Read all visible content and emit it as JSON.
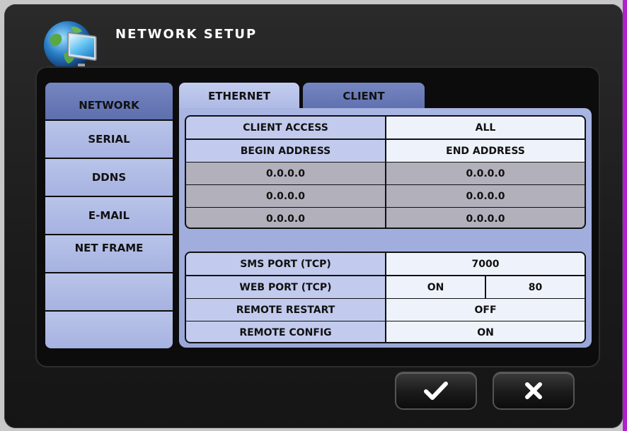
{
  "dialog": {
    "title": "NETWORK SETUP",
    "logo_icon": "globe-monitor-icon"
  },
  "sidebar": {
    "items": [
      {
        "label": "NETWORK",
        "active": true
      },
      {
        "label": "SERIAL",
        "active": false
      },
      {
        "label": "DDNS",
        "active": false
      },
      {
        "label": "E-MAIL",
        "active": false
      },
      {
        "label": "NET FRAME",
        "active": false
      },
      {
        "label": "",
        "active": false
      },
      {
        "label": "",
        "active": false
      }
    ]
  },
  "tabs": [
    {
      "label": "ETHERNET",
      "active": false
    },
    {
      "label": "CLIENT",
      "active": true
    }
  ],
  "client_table": {
    "access_label": "CLIENT ACCESS",
    "access_value": "ALL",
    "begin_header": "BEGIN ADDRESS",
    "end_header": "END ADDRESS",
    "ranges": [
      {
        "begin": "0.0.0.0",
        "end": "0.0.0.0"
      },
      {
        "begin": "0.0.0.0",
        "end": "0.0.0.0"
      },
      {
        "begin": "0.0.0.0",
        "end": "0.0.0.0"
      }
    ]
  },
  "port_table": {
    "sms_port_label": "SMS PORT (TCP)",
    "sms_port_value": "7000",
    "web_port_label": "WEB PORT (TCP)",
    "web_port_state": "ON",
    "web_port_value": "80",
    "remote_restart_label": "REMOTE RESTART",
    "remote_restart_value": "OFF",
    "remote_config_label": "REMOTE CONFIG",
    "remote_config_value": "ON"
  },
  "buttons": {
    "ok_icon": "checkmark-icon",
    "cancel_icon": "close-icon"
  },
  "colors": {
    "active_tab": "#6a7bb8",
    "inactive_tab": "#b8c3ea",
    "panel": "#a2aedd",
    "window": "#1e1e1e"
  }
}
